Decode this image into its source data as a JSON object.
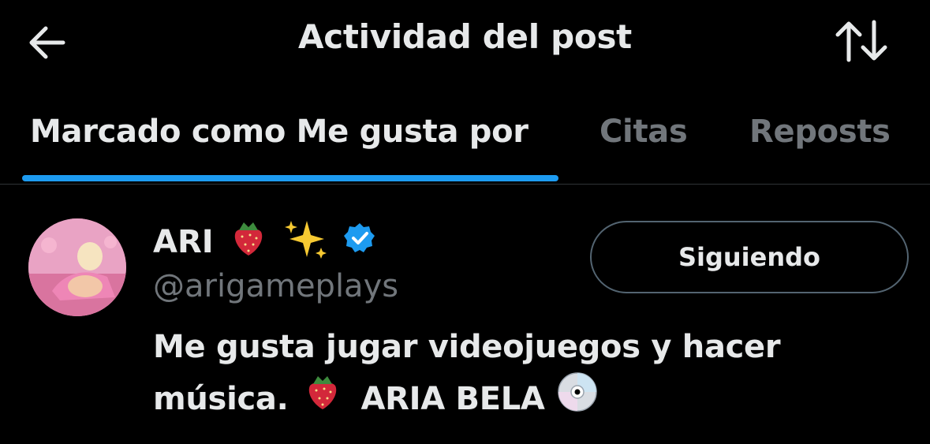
{
  "header": {
    "title": "Actividad del post",
    "back_icon": "arrow-left-icon",
    "sort_icon": "sort-arrows-icon"
  },
  "tabs": [
    {
      "label": "Marcado como Me gusta por",
      "active": true
    },
    {
      "label": "Citas",
      "active": false
    },
    {
      "label": "Reposts",
      "active": false
    }
  ],
  "user": {
    "name": "ARI",
    "name_emojis": [
      "strawberry-emoji",
      "sparkles-emoji"
    ],
    "verified": true,
    "handle": "@arigameplays",
    "follow_label": "Siguiendo",
    "bio_line1": "Me gusta jugar videojuegos y hacer",
    "bio_line2_text1": "música.",
    "bio_line2_text2": "ARIA BELA"
  },
  "colors": {
    "background": "#000000",
    "text_primary": "#e7e9ea",
    "text_secondary": "#71767b",
    "accent": "#1d9bf0",
    "divider": "#2f3336"
  }
}
